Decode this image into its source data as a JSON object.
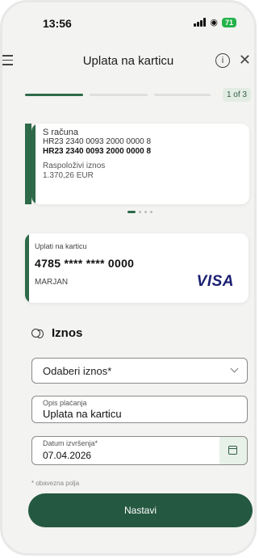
{
  "status_bar": {
    "time": "13:56",
    "battery": "71"
  },
  "header": {
    "title": "Uplata na karticu",
    "info_icon": "info-icon",
    "close_icon": "close-icon",
    "menu_icon": "hamburger-menu-icon"
  },
  "progress": {
    "step_label": "1 of 3",
    "current_step": 1,
    "total_steps": 3
  },
  "account": {
    "label": "S računa",
    "iban_plain": "HR23 2340 0093 2000 0000 8",
    "iban_bold": "HR23 2340 0093 2000 0000 8",
    "available_label": "Raspoloživi iznos",
    "available_value": "1.370,26 EUR"
  },
  "carousel": {
    "pages": 4,
    "active": 0
  },
  "card": {
    "label": "Uplati na karticu",
    "number": "4785 **** **** 0000",
    "holder": "MARJAN",
    "brand": "VISA"
  },
  "amount_section": {
    "title": "Iznos",
    "amount_select": "Odaberi iznos*",
    "description_label": "Opis plaćanja",
    "description_value": "Uplata na karticu",
    "date_label": "Datum izvršenja*",
    "date_value": "07.04.2026",
    "required_note": "* obavezna polja"
  },
  "actions": {
    "continue": "Nastavi"
  },
  "colors": {
    "primary": "#245841",
    "accent": "#2d6a4a",
    "background": "#f3f3f1"
  }
}
